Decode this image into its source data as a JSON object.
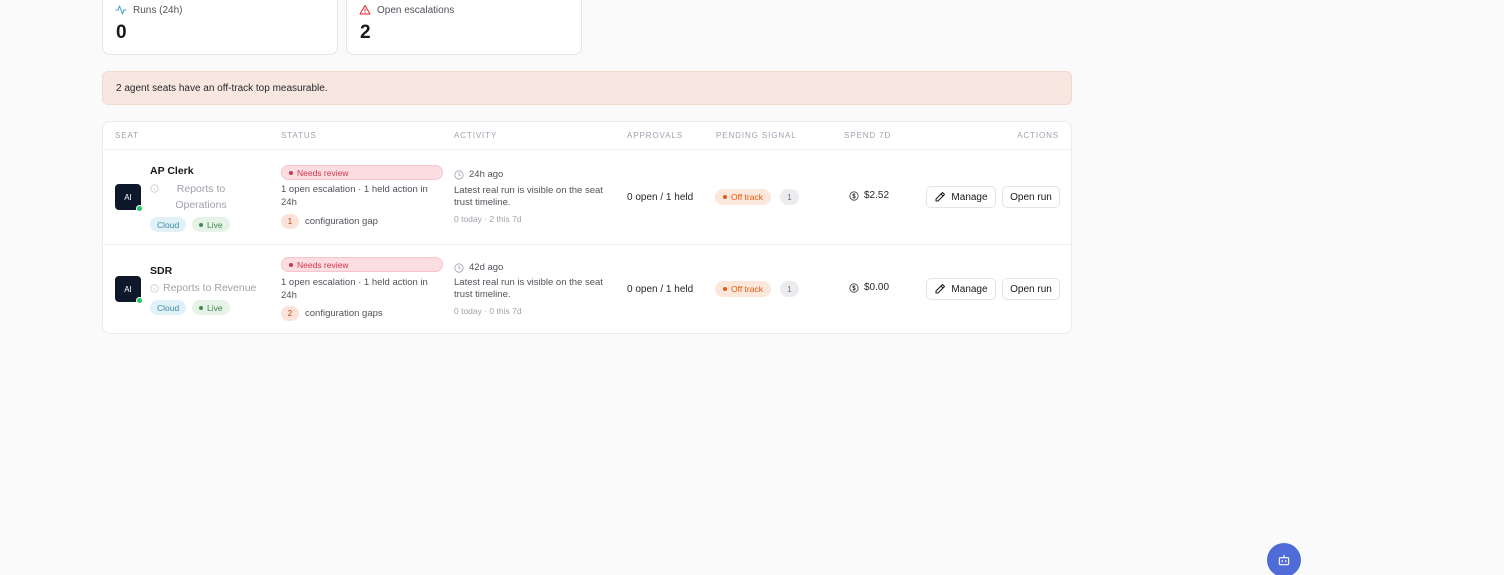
{
  "stats": [
    {
      "label": "Runs (24h)",
      "value": "0",
      "icon": "activity-icon",
      "color": "#3b9bd6"
    },
    {
      "label": "Open escalations",
      "value": "2",
      "icon": "alert-triangle-icon",
      "color": "#dc2626"
    }
  ],
  "alert": {
    "text": "2 agent seats have an off-track top measurable."
  },
  "table": {
    "headers": {
      "seat": "SEAT",
      "status": "STATUS",
      "activity": "ACTIVITY",
      "approvals": "APPROVALS",
      "pending_signal": "PENDING SIGNAL",
      "spend": "SPEND 7D",
      "actions": "ACTIONS"
    },
    "rows": [
      {
        "avatar": "AI",
        "name": "AP Clerk",
        "reports_line1": "Reports to",
        "reports_line2": "Operations",
        "chip_cloud": "Cloud",
        "chip_live": "Live",
        "status_badge": "Needs review",
        "status_line1": "1 open escalation · 1 held action in",
        "status_line2": "24h",
        "gap_count": "1",
        "gap_label": "configuration gap",
        "activity_time": "24h ago",
        "activity_line1": "Latest real run is visible on the seat",
        "activity_line2": "trust timeline.",
        "activity_meta": "0 today · 2 this 7d",
        "approvals": "0 open / 1 held",
        "signal": "Off track",
        "signal_count": "1",
        "spend": "$2.52",
        "manage_label": "Manage",
        "open_label": "Open run"
      },
      {
        "avatar": "AI",
        "name": "SDR",
        "reports_line1": "Reports to Revenue",
        "chip_cloud": "Cloud",
        "chip_live": "Live",
        "status_badge": "Needs review",
        "status_line1": "1 open escalation · 1 held action in",
        "status_line2": "24h",
        "gap_count": "2",
        "gap_label": "configuration gaps",
        "activity_time": "42d ago",
        "activity_line1": "Latest real run is visible on the seat",
        "activity_line2": "trust timeline.",
        "activity_meta": "0 today · 0 this 7d",
        "approvals": "0 open / 1 held",
        "signal": "Off track",
        "signal_count": "1",
        "spend": "$0.00",
        "manage_label": "Manage",
        "open_label": "Open run"
      }
    ]
  },
  "fab": {
    "icon": "bot-icon",
    "color": "#4f6bd8"
  }
}
